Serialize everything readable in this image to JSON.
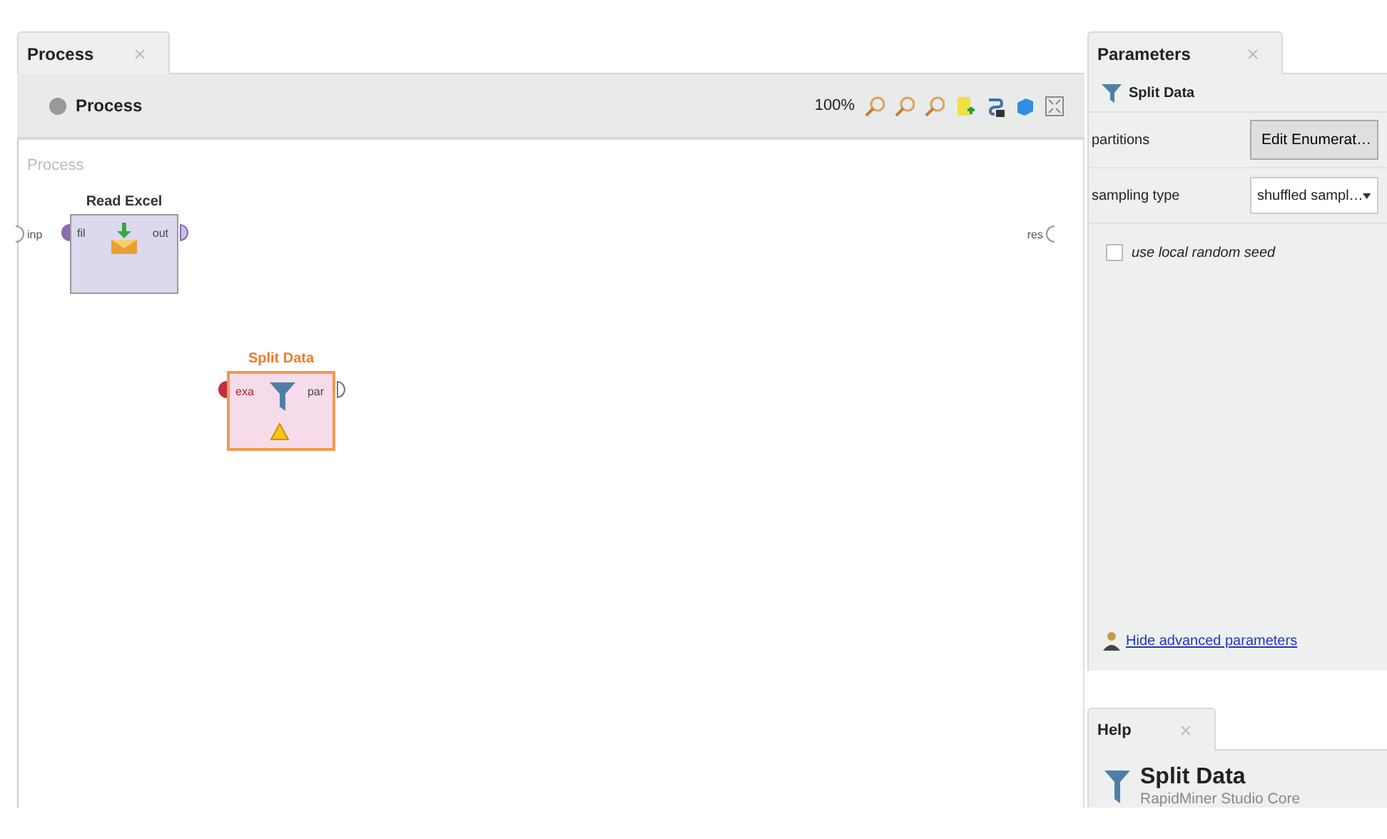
{
  "process_panel": {
    "tab": "Process",
    "toolbar_title": "Process",
    "zoom": "100%"
  },
  "canvas": {
    "breadcrumb": "Process",
    "left_port": "inp",
    "right_port": "res",
    "operators": [
      {
        "name": "Read Excel",
        "kind": "read",
        "in_port": "fil",
        "out_port": "out",
        "warning": false,
        "selected": false
      },
      {
        "name": "Split Data",
        "kind": "split",
        "in_port": "exa",
        "out_port": "par",
        "warning": true,
        "selected": true
      }
    ]
  },
  "parameters": {
    "tab": "Parameters",
    "operator": "Split Data",
    "rows": [
      {
        "kind": "button",
        "label": "partitions",
        "value": "Edit Enumerat…"
      },
      {
        "kind": "dropdown",
        "label": "sampling type",
        "value": "shuffled sampl…"
      },
      {
        "kind": "checkbox",
        "label": "use local random seed",
        "checked": false
      }
    ],
    "link": "Hide advanced parameters"
  },
  "help": {
    "tab": "Help",
    "title": "Split Data",
    "subtitle": "RapidMiner Studio Core"
  }
}
